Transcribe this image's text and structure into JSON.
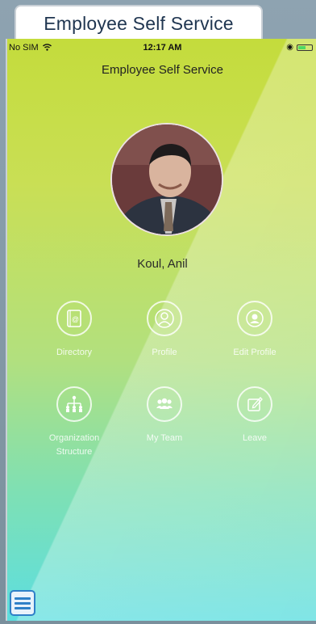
{
  "window": {
    "title": "Employee Self Service"
  },
  "status_bar": {
    "carrier": "No SIM",
    "time": "12:17 AM"
  },
  "header": {
    "title": "Employee Self Service"
  },
  "user": {
    "name": "Koul, Anil"
  },
  "menu": [
    {
      "label": "Directory",
      "icon": "directory-icon"
    },
    {
      "label": "Profile",
      "icon": "profile-icon"
    },
    {
      "label": "Edit Profile",
      "icon": "edit-profile-icon"
    },
    {
      "label": "Organization Structure",
      "icon": "organization-structure-icon"
    },
    {
      "label": "My Team",
      "icon": "team-icon"
    },
    {
      "label": "Leave",
      "icon": "leave-icon"
    }
  ],
  "colors": {
    "gradient_top": "#c4dc3c",
    "gradient_bottom": "#5cdee0",
    "title_text": "#1f3550",
    "hamburger": "#2f80c8"
  }
}
